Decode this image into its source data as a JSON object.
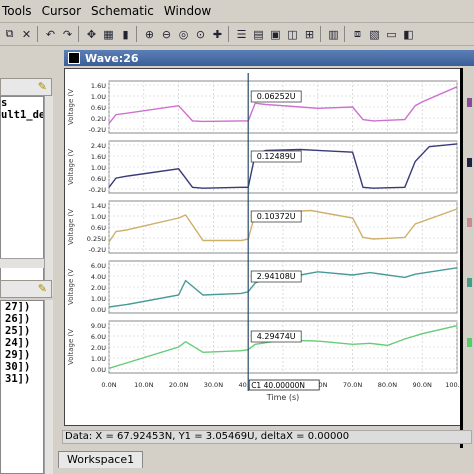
{
  "menu": [
    "Tools",
    "Cursor",
    "Schematic",
    "Window"
  ],
  "left_panel": {
    "tree_top": [
      "s",
      "ult1_default"
    ],
    "tree_bottom": [
      "27])",
      "26])",
      "25])",
      "24])",
      "29])",
      "30])",
      "31])"
    ]
  },
  "wave": {
    "title": "Wave:26",
    "y_axis_label": "Voltage (V",
    "x_axis_label": "Time (s)",
    "x_ticks": [
      "0.0N",
      "10.0N",
      "20.0N",
      "30.0N",
      "40.0N",
      "50.0N",
      "60.0N",
      "70.0N",
      "80.0N",
      "90.0N",
      "100.0N"
    ],
    "cursor_label": "C1  40.00000N",
    "status": "Data: X = 67.92453N,  Y1 = 3.05469U,  deltaX = 0.00000",
    "workspace_tab": "Workspace1"
  },
  "chart_data": [
    {
      "type": "line",
      "ylabel": "Voltage (V",
      "color": "#cf6fcf",
      "ylim": [
        -0.2,
        1.7
      ],
      "y_ticks": [
        "1.6U",
        "1.0U",
        "0.6U",
        "0.2U",
        "-0.2U"
      ],
      "marker": "0.06252U",
      "series": [
        {
          "x": [
            0,
            2,
            5,
            20,
            24,
            27,
            38,
            40,
            42,
            45,
            50,
            55,
            60,
            70,
            73,
            76,
            85,
            88,
            90,
            100
          ],
          "values": [
            0.1,
            0.45,
            0.5,
            0.8,
            0.2,
            0.18,
            0.2,
            0.2,
            0.9,
            0.85,
            0.8,
            0.75,
            0.7,
            0.75,
            0.25,
            0.2,
            0.25,
            0.8,
            0.95,
            1.55
          ]
        }
      ]
    },
    {
      "type": "line",
      "ylabel": "Voltage (V",
      "color": "#3a3a7a",
      "ylim": [
        -0.2,
        2.4
      ],
      "y_ticks": [
        "2.4U",
        "1.6U",
        "1.0U",
        "0.6U",
        "-0.2U"
      ],
      "marker": "0.12489U",
      "series": [
        {
          "x": [
            0,
            2,
            5,
            20,
            24,
            27,
            38,
            40,
            42,
            45,
            55,
            60,
            70,
            73,
            76,
            85,
            88,
            92,
            100
          ],
          "values": [
            0.0,
            0.5,
            0.6,
            1.0,
            0.0,
            -0.05,
            0.0,
            0.0,
            1.8,
            2.0,
            2.05,
            2.0,
            1.9,
            0.0,
            -0.05,
            0.0,
            1.4,
            2.2,
            2.35
          ]
        }
      ]
    },
    {
      "type": "line",
      "ylabel": "Voltage (V",
      "color": "#cdb06a",
      "ylim": [
        -0.2,
        1.4
      ],
      "y_ticks": [
        "1.4U",
        "1.0U",
        "0.6U",
        "0.25U",
        "-0.2U"
      ],
      "marker": "0.10372U",
      "series": [
        {
          "x": [
            0,
            2,
            5,
            20,
            22,
            27,
            38,
            40,
            42,
            50,
            58,
            70,
            73,
            76,
            85,
            88,
            100
          ],
          "values": [
            0.1,
            0.45,
            0.5,
            0.9,
            1.0,
            0.15,
            0.15,
            0.2,
            1.05,
            1.1,
            1.15,
            0.9,
            0.25,
            0.2,
            0.25,
            0.7,
            1.2
          ]
        }
      ]
    },
    {
      "type": "line",
      "ylabel": "Voltage (V",
      "color": "#4a9a9a",
      "ylim": [
        0,
        6
      ],
      "y_ticks": [
        "6.0U",
        "4.0U",
        "2.0U",
        "1.0U",
        "0.0U"
      ],
      "marker": "2.94108U",
      "series": [
        {
          "x": [
            0,
            5,
            20,
            22,
            27,
            38,
            40,
            42,
            50,
            55,
            60,
            70,
            75,
            85,
            88,
            100
          ],
          "values": [
            0.5,
            0.8,
            2.0,
            3.8,
            2.0,
            2.2,
            2.4,
            3.5,
            4.8,
            4.5,
            4.9,
            4.5,
            4.8,
            4.2,
            4.6,
            5.4
          ]
        }
      ]
    },
    {
      "type": "line",
      "ylabel": "Voltage (V",
      "color": "#66cc77",
      "ylim": [
        0,
        9
      ],
      "y_ticks": [
        "9.0U",
        "6.0U",
        "2.0U",
        "1.0U",
        "0.0U"
      ],
      "marker": "4.29474U",
      "series": [
        {
          "x": [
            0,
            5,
            20,
            22,
            27,
            38,
            40,
            42,
            50,
            60,
            70,
            75,
            80,
            85,
            90,
            100
          ],
          "values": [
            0.5,
            1.5,
            4.5,
            5.5,
            3.5,
            3.8,
            4.0,
            5.0,
            5.8,
            5.6,
            5.0,
            5.2,
            4.8,
            6.0,
            7.0,
            8.5
          ]
        }
      ]
    }
  ],
  "colors": {
    "legend_swatches": [
      "#8a4a9a",
      "#202040",
      "#c88a8a",
      "#4a9a8a",
      "#55cc66"
    ]
  }
}
